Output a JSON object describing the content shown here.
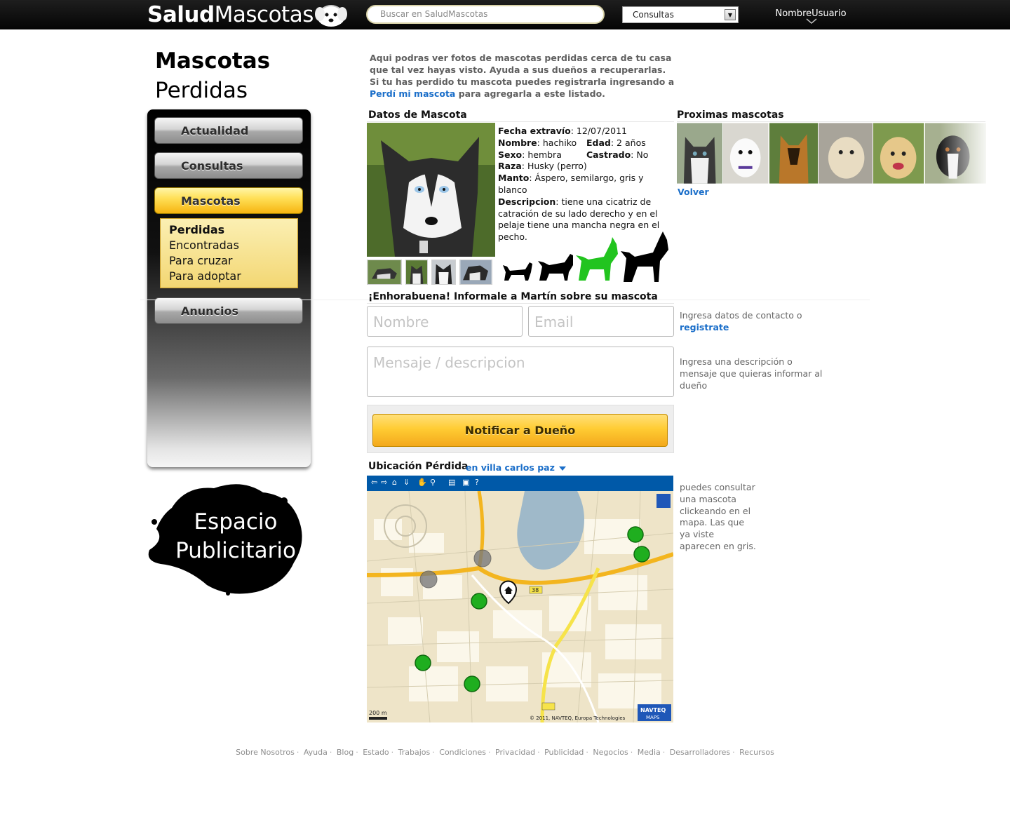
{
  "header": {
    "logo_bold": "Salud",
    "logo_light": "Mascotas",
    "search_placeholder": "Buscar en SaludMascotas",
    "select_value": "Consultas",
    "username": "NombreUsuario"
  },
  "page": {
    "title_line1": "Mascotas",
    "title_line2": "Perdidas"
  },
  "sidebar": {
    "items": [
      {
        "label": "Actualidad"
      },
      {
        "label": "Consultas"
      },
      {
        "label": "Mascotas"
      },
      {
        "label": "Anuncios"
      }
    ],
    "submenu": [
      {
        "label": "Perdidas"
      },
      {
        "label": "Encontradas"
      },
      {
        "label": "Para cruzar"
      },
      {
        "label": "Para adoptar"
      }
    ]
  },
  "ad": {
    "line1": "Espacio",
    "line2": "Publicitario"
  },
  "intro": {
    "text1": "Aqui podras ver fotos de mascotas perdidas cerca de tu casa que tal vez hayas visto. Ayuda a sus dueños a recuperarlas.",
    "text2": "Si tu has perdido tu mascota puedes registrarla ingresando a",
    "link": "Perdí mi mascota",
    "text3": " para agregarla a este listado."
  },
  "pet": {
    "heading": "Datos de Mascota",
    "fecha_label": "Fecha extravío",
    "fecha_value": ": 12/07/2011",
    "nombre_label": "Nombre",
    "nombre_value": ": hachiko",
    "edad_label": "Edad",
    "edad_value": ": 2 años",
    "sexo_label": "Sexo",
    "sexo_value": ":  hembra",
    "castrado_label": "Castrado",
    "castrado_value": ": No",
    "raza_label": "Raza",
    "raza_value": ": Husky (perro)",
    "manto_label": "Manto",
    "manto_value": ": Áspero, semilargo, gris y blanco",
    "desc_label": "Descripcion",
    "desc_value": ": tiene una cicatriz de catración de su lado derecho y en el pelaje tiene una mancha negra en el pecho."
  },
  "next": {
    "heading": "Proximas mascotas",
    "volver": "Volver"
  },
  "contact": {
    "heading": "¡Enhorabuena! Informale a Martín sobre su mascota",
    "nombre_placeholder": "Nombre",
    "email_placeholder": "Email",
    "mensaje_placeholder": "Mensaje / descripcion",
    "hint1_text": "Ingresa datos de contacto o",
    "hint1_link": "registrate",
    "hint2": "Ingresa una descripción o mensaje que quieras informar al dueño",
    "button": "Notificar a Dueño"
  },
  "location": {
    "heading": "Ubicación Pérdida",
    "place": "en villa carlos paz",
    "hint": "puedes consultar una mascota clickeando en el mapa. Las que ya viste aparecen en gris.",
    "scale": "200 m",
    "copyright": "© 2011, NAVTEQ, Europa Technologies",
    "brand_line1": "NAVTEQ",
    "brand_line2": "MAPS",
    "route_label": "38"
  },
  "footer": {
    "links": [
      "Sobre Nosotros",
      "Ayuda",
      "Blog",
      "Estado",
      "Trabajos",
      "Condiciones",
      "Privacidad",
      "Publicidad",
      "Negocios",
      "Media",
      "Desarrolladores",
      "Recursos"
    ]
  },
  "colors": {
    "accent_link": "#1a6ec9",
    "active_nav": "#ffcc33",
    "topbar": "#0b0b0b",
    "map_toolbar": "#0059a8",
    "marker_green": "#1fae1f"
  }
}
